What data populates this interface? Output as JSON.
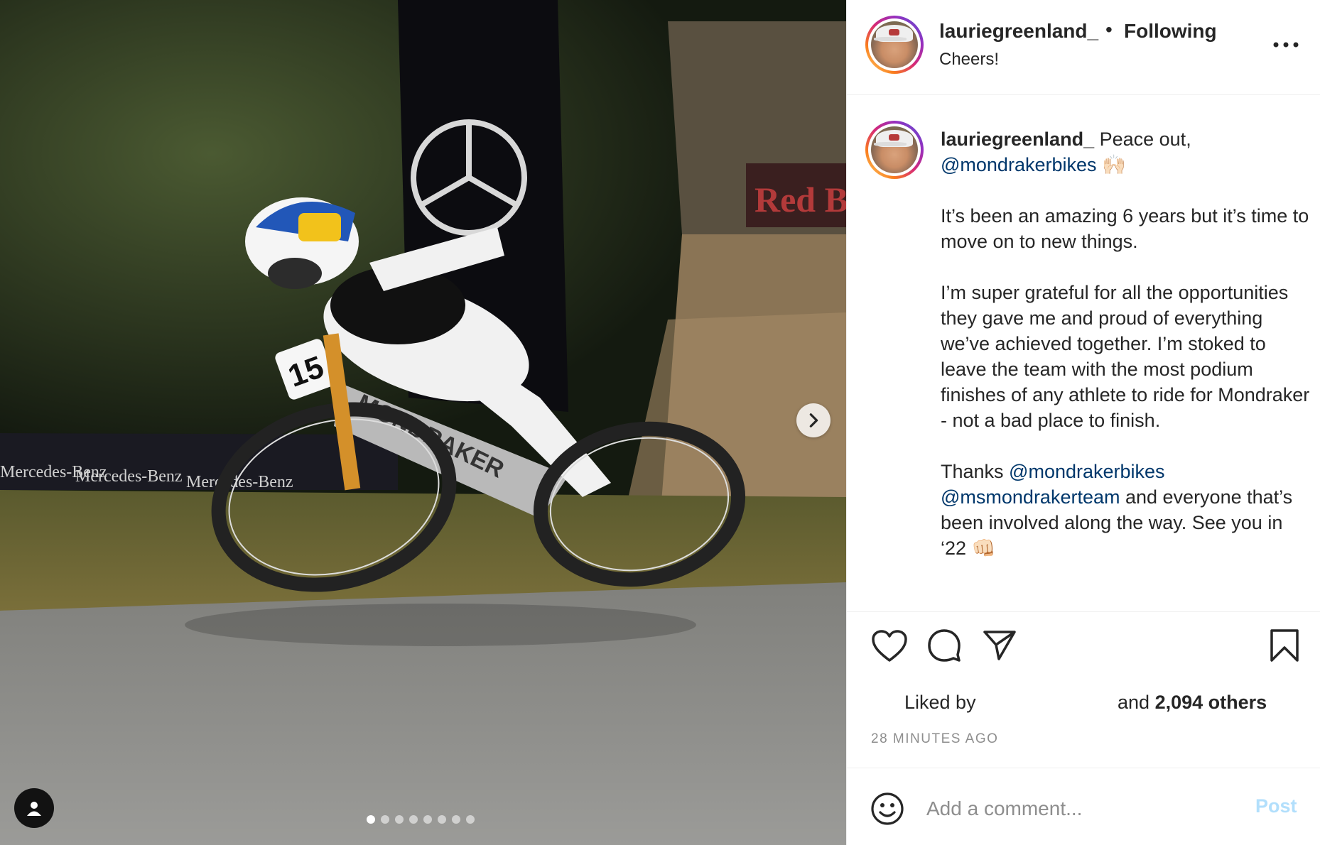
{
  "header": {
    "username": "lauriegreenland_",
    "bullet": "•",
    "follow_label": "Following",
    "location": "Cheers!"
  },
  "caption": {
    "username": "lauriegreenland_",
    "line1_text": " Peace out,",
    "mention1": "@mondrakerbikes",
    "emoji1": " 🙌🏻",
    "para1": "It’s been an amazing 6 years but it’s time to move on to new things.",
    "para2": "I’m super grateful for all the opportunities they gave me and proud of everything we’ve achieved together. I’m stoked to leave the team with the most podium finishes of any athlete to ride for Mondraker - not a bad place to finish.",
    "para3_start": "Thanks ",
    "mention2": "@mondrakerbikes",
    "mention3": "@msmondrakerteam",
    "para3_end": " and everyone that’s been involved along the way. See you in ‘22 ",
    "emoji2": "👊🏻"
  },
  "photo": {
    "banner_text": "Mercedes-Benz",
    "bib_number": "15",
    "bike_brand": "MONDRAKER",
    "brand_banner": "Red Bull"
  },
  "carousel": {
    "total_slides": 8,
    "active_index": 0
  },
  "likes": {
    "prefix": "Liked by",
    "middle": "and ",
    "count": "2,094 others"
  },
  "timestamp": "28 MINUTES AGO",
  "comment": {
    "placeholder": "Add a comment...",
    "post_label": "Post"
  },
  "colors": {
    "post_disabled": "#b2dffc",
    "mention": "#00376b",
    "muted": "#8e8e8e"
  },
  "icons": [
    "heart-icon",
    "comment-icon",
    "share-icon",
    "bookmark-icon",
    "more-icon",
    "chevron-right-icon",
    "user-tag-icon",
    "emoji-icon"
  ]
}
